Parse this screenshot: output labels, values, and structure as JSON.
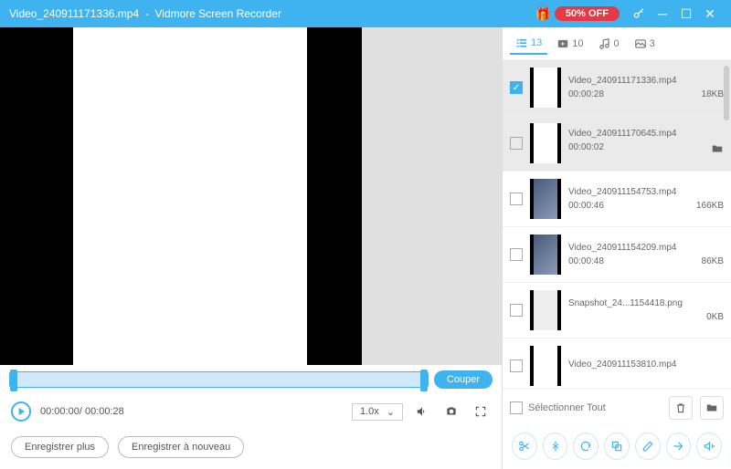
{
  "titlebar": {
    "filename": "Video_240911171336.mp4",
    "separator": "-",
    "app": "Vidmore Screen Recorder",
    "promo": "50% OFF"
  },
  "tabs": {
    "list_count": "13",
    "video_count": "10",
    "audio_count": "0",
    "image_count": "3"
  },
  "items": [
    {
      "name": "Video_240911171336.mp4",
      "dur": "00:00:28",
      "size": "18KB",
      "checked": true,
      "sel": true,
      "thumb": "vid"
    },
    {
      "name": "Video_240911170645.mp4",
      "dur": "00:00:02",
      "size": "",
      "checked": false,
      "sel": true,
      "thumb": "vid",
      "folder": true
    },
    {
      "name": "Video_240911154753.mp4",
      "dur": "00:00:46",
      "size": "166KB",
      "checked": false,
      "sel": false,
      "thumb": "img"
    },
    {
      "name": "Video_240911154209.mp4",
      "dur": "00:00:48",
      "size": "86KB",
      "checked": false,
      "sel": false,
      "thumb": "img"
    },
    {
      "name": "Snapshot_24...1154418.png",
      "dur": "",
      "size": "0KB",
      "checked": false,
      "sel": false,
      "thumb": "blank"
    },
    {
      "name": "Video_240911153810.mp4",
      "dur": "",
      "size": "",
      "checked": false,
      "sel": false,
      "thumb": "vid"
    }
  ],
  "cut_label": "Couper",
  "time": {
    "current": "00:00:00",
    "total": "00:00:28"
  },
  "speed": "1.0x",
  "buttons": {
    "save_more": "Enregistrer plus",
    "save_again": "Enregistrer à nouveau"
  },
  "select_all": "Sélectionner Tout"
}
